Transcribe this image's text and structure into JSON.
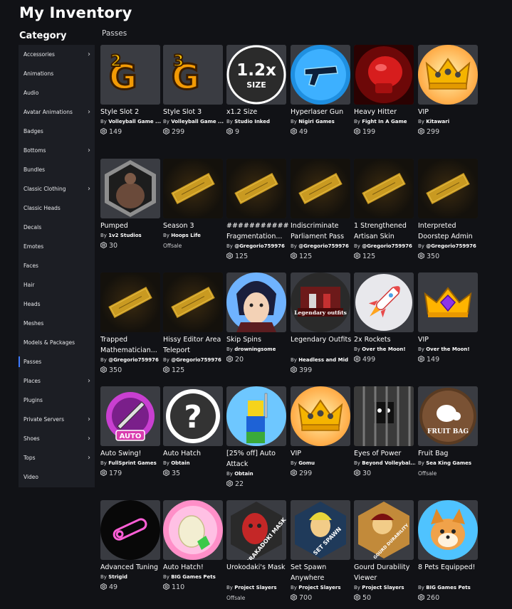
{
  "page": {
    "title": "My Inventory",
    "category_heading": "Category",
    "section_heading": "Passes"
  },
  "sidebar": {
    "items": [
      {
        "label": "Accessories",
        "chevron": true
      },
      {
        "label": "Animations",
        "chevron": false
      },
      {
        "label": "Audio",
        "chevron": false
      },
      {
        "label": "Avatar Animations",
        "chevron": true
      },
      {
        "label": "Badges",
        "chevron": false
      },
      {
        "label": "Bottoms",
        "chevron": true
      },
      {
        "label": "Bundles",
        "chevron": false
      },
      {
        "label": "Classic Clothing",
        "chevron": true
      },
      {
        "label": "Classic Heads",
        "chevron": false
      },
      {
        "label": "Decals",
        "chevron": false
      },
      {
        "label": "Emotes",
        "chevron": false
      },
      {
        "label": "Faces",
        "chevron": false
      },
      {
        "label": "Hair",
        "chevron": false
      },
      {
        "label": "Heads",
        "chevron": false
      },
      {
        "label": "Meshes",
        "chevron": false
      },
      {
        "label": "Models & Packages",
        "chevron": false
      },
      {
        "label": "Passes",
        "chevron": false,
        "active": true
      },
      {
        "label": "Places",
        "chevron": true
      },
      {
        "label": "Plugins",
        "chevron": false
      },
      {
        "label": "Private Servers",
        "chevron": true
      },
      {
        "label": "Shoes",
        "chevron": true
      },
      {
        "label": "Tops",
        "chevron": true
      },
      {
        "label": "Video",
        "chevron": false
      }
    ]
  },
  "colors": {
    "accent": "#3d7bff",
    "background": "#111216",
    "sidebar": "#1c1e24",
    "card": "#393b41"
  },
  "passes": [
    {
      "name": "Style Slot 2",
      "creator_prefix": "By",
      "creator": "Volleyball Game ...",
      "price": "149",
      "icon": "style-slot-2-icon"
    },
    {
      "name": "Style Slot 3",
      "creator_prefix": "By",
      "creator": "Volleyball Game ...",
      "price": "299",
      "icon": "style-slot-3-icon"
    },
    {
      "name": "x1.2 Size",
      "creator_prefix": "By",
      "creator": "Studio Inked",
      "price": "9",
      "icon": "size-badge-icon",
      "icon_text_big": "1.2x",
      "icon_text_small": "SIZE"
    },
    {
      "name": "Hyperlaser Gun",
      "creator_prefix": "By",
      "creator": "Nigiri Games",
      "price": "49",
      "icon": "laser-gun-icon"
    },
    {
      "name": "Heavy Hitter",
      "creator_prefix": "By",
      "creator": "Fight In A Game",
      "price": "199",
      "icon": "boxing-glove-icon"
    },
    {
      "name": "VIP",
      "creator_prefix": "By",
      "creator": "Kitawari",
      "price": "299",
      "icon": "vip-crown-icon"
    },
    {
      "name": "Pumped",
      "creator_prefix": "By",
      "creator": "1v2 Studios",
      "price": "30",
      "icon": "muscle-man-icon"
    },
    {
      "name": "Season 3",
      "creator_prefix": "By",
      "creator": "Hoops Life",
      "price": "",
      "status": "Offsale",
      "icon": "golden-ticket-icon"
    },
    {
      "name": "########### Fragmentation...",
      "creator_prefix": "By",
      "creator": "@Gregorio759976",
      "price": "125",
      "icon": "golden-ticket-icon"
    },
    {
      "name": "Indiscriminate Parliament Pass",
      "creator_prefix": "By",
      "creator": "@Gregorio759976",
      "price": "125",
      "icon": "golden-ticket-icon"
    },
    {
      "name": "1 Strengthened Artisan Skin",
      "creator_prefix": "By",
      "creator": "@Gregorio759976",
      "price": "125",
      "icon": "golden-ticket-icon"
    },
    {
      "name": "Interpreted Doorstep Admin",
      "creator_prefix": "By",
      "creator": "@Gregorio759976",
      "price": "350",
      "icon": "golden-ticket-icon"
    },
    {
      "name": "Trapped Mathematician...",
      "creator_prefix": "By",
      "creator": "@Gregorio759976",
      "price": "350",
      "icon": "golden-ticket-icon"
    },
    {
      "name": "Hissy Editor Area Teleport",
      "creator_prefix": "By",
      "creator": "@Gregorio759976",
      "price": "125",
      "icon": "golden-ticket-icon"
    },
    {
      "name": "Skip Spins",
      "creator_prefix": "By",
      "creator": "drowningsome",
      "price": "20",
      "icon": "anime-character-icon"
    },
    {
      "name": "Legendary Outfits",
      "creator_prefix": "By",
      "creator": "Headless and Mid",
      "price": "399",
      "icon": "legendary-outfits-icon",
      "icon_text_big": "Legendary outfits"
    },
    {
      "name": "2x Rockets",
      "creator_prefix": "By",
      "creator": "Over the Moon!",
      "price": "499",
      "icon": "rocket-icon"
    },
    {
      "name": "VIP",
      "creator_prefix": "By",
      "creator": "Over the Moon!",
      "price": "149",
      "icon": "purple-gem-crown-icon"
    },
    {
      "name": "Auto Swing!",
      "creator_prefix": "By",
      "creator": "FullSprint Games",
      "price": "179",
      "icon": "auto-swing-icon",
      "icon_text_big": "AUTO"
    },
    {
      "name": "Auto Hatch",
      "creator_prefix": "By",
      "creator": "Obtain",
      "price": "35",
      "icon": "question-mark-icon",
      "icon_text_big": "?"
    },
    {
      "name": "[25% off] Auto Attack",
      "creator_prefix": "By",
      "creator": "Obtain",
      "price": "22",
      "icon": "sword-noob-icon"
    },
    {
      "name": "VIP",
      "creator_prefix": "By",
      "creator": "Gomu",
      "price": "299",
      "icon": "vip-crown-icon"
    },
    {
      "name": "Eyes of Power",
      "creator_prefix": "By",
      "creator": "Beyond Volleybal...",
      "price": "30",
      "icon": "caged-eyes-icon"
    },
    {
      "name": "Fruit Bag",
      "creator_prefix": "By",
      "creator": "Sea King Games",
      "price": "",
      "status": "Offsale",
      "icon": "fruit-bag-icon",
      "icon_text_big": "FRUIT BAG"
    },
    {
      "name": "Advanced Tuning",
      "creator_prefix": "By",
      "creator": "Strigid",
      "price": "49",
      "icon": "neon-tuning-icon"
    },
    {
      "name": "Auto Hatch!",
      "creator_prefix": "By",
      "creator": "BIG Games Pets",
      "price": "110",
      "icon": "egg-icon"
    },
    {
      "name": "Urokodaki's Mask",
      "creator_prefix": "By",
      "creator": "Project Slayers",
      "price": "",
      "status": "Offsale",
      "icon": "urokodaki-mask-icon",
      "icon_text_big": "URAKADOKI MASK"
    },
    {
      "name": "Set Spawn Anywhere",
      "creator_prefix": "By",
      "creator": "Project Slayers",
      "price": "700",
      "icon": "set-spawn-icon",
      "icon_text_big": "SET SPAWN"
    },
    {
      "name": "Gourd Durability Viewer",
      "creator_prefix": "By",
      "creator": "Project Slayers",
      "price": "50",
      "icon": "gourd-durability-icon",
      "icon_text_big": "GOURD DURABILITY"
    },
    {
      "name": "8 Pets Equipped!",
      "creator_prefix": "By",
      "creator": "BIG Games Pets",
      "price": "260",
      "icon": "pet-dog-icon"
    }
  ]
}
